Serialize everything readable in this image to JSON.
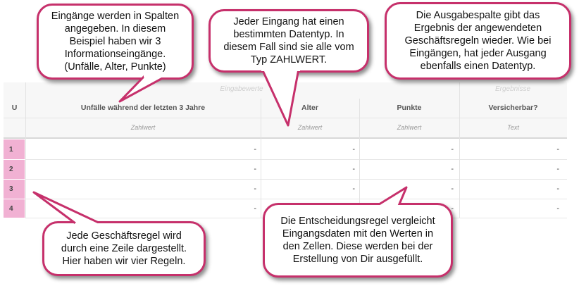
{
  "table": {
    "group_inputs": "Eingabewerte",
    "group_outputs": "Ergebnisse",
    "col_hit": "U",
    "columns": [
      {
        "label": "Unfälle während der letzten 3 Jahre",
        "type": "Zahlwert"
      },
      {
        "label": "Alter",
        "type": "Zahlwert"
      },
      {
        "label": "Punkte",
        "type": "Zahlwert"
      }
    ],
    "output": {
      "label": "Versicherbar?",
      "type": "Text"
    },
    "rows": [
      {
        "num": "1",
        "cells": [
          "-",
          "-",
          "-",
          "-"
        ]
      },
      {
        "num": "2",
        "cells": [
          "-",
          "-",
          "-",
          "-"
        ]
      },
      {
        "num": "3",
        "cells": [
          "-",
          "-",
          "-",
          "-"
        ]
      },
      {
        "num": "4",
        "cells": [
          "-",
          "-",
          "-",
          "-"
        ]
      }
    ]
  },
  "callouts": {
    "inputs": "Eingänge werden in Spalten angegeben. In diesem Beispiel haben wir 3 Informationseingänge. (Unfälle, Alter, Punkte)",
    "datatype": "Jeder Eingang hat einen bestimmten Datentyp. In diesem Fall sind sie alle vom Typ ZAHLWERT.",
    "output": "Die Ausgabespalte gibt das Ergebnis der angewendeten Geschäftsregeln wieder. Wie bei Eingängen, hat jeder Ausgang ebenfalls einen Datentyp.",
    "rows": "Jede Geschäftsregel wird durch eine Zeile dargestellt. Hier haben wir vier Regeln.",
    "cells": "Die Entscheidungsregel vergleicht Eingangsdaten mit den Werten in den Zellen. Diese werden bei der Erstellung von Dir ausgefüllt."
  }
}
